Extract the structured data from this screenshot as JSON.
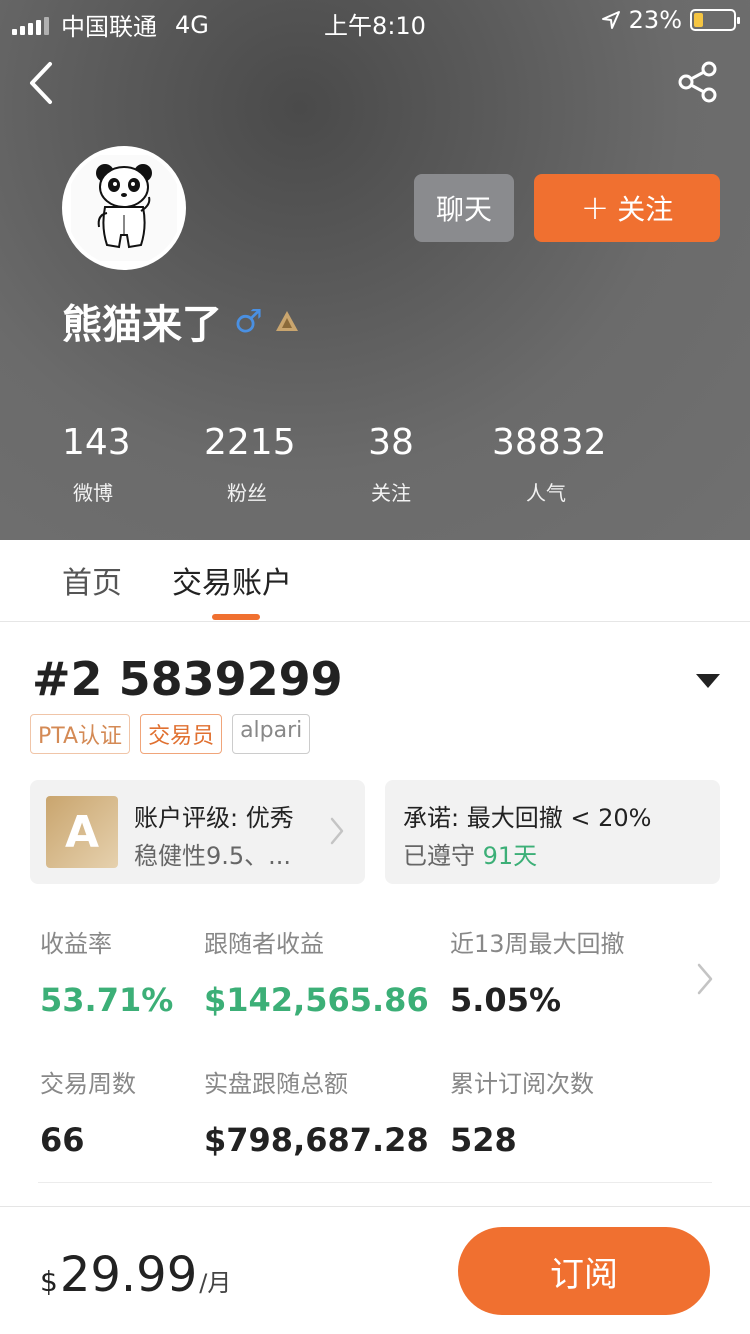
{
  "status_bar": {
    "carrier": "中国联通",
    "network": "4G",
    "time": "上午8:10",
    "battery": "23%",
    "battery_level": 0.23
  },
  "profile": {
    "name": "熊猫来了",
    "chat_label": "聊天",
    "follow_label": "关注",
    "stats": [
      {
        "value": "143",
        "label": "微博"
      },
      {
        "value": "2215",
        "label": "粉丝"
      },
      {
        "value": "38",
        "label": "关注"
      },
      {
        "value": "38832",
        "label": "人气"
      }
    ]
  },
  "tabs": [
    {
      "label": "首页",
      "active": false
    },
    {
      "label": "交易账户",
      "active": true
    }
  ],
  "account": {
    "id": "#2 5839299",
    "tags": [
      "PTA认证",
      "交易员",
      "alpari"
    ],
    "rating_card": {
      "grade": "A",
      "title": "账户评级: 优秀",
      "subtitle": "稳健性9.5、..."
    },
    "commitment_card": {
      "title": "承诺: 最大回撤 < 20%",
      "subtitle_prefix": "已遵守",
      "days": "91天"
    },
    "metrics": [
      {
        "label": "收益率",
        "value": "53.71%",
        "highlight": true
      },
      {
        "label": "跟随者收益",
        "value": "$142,565.86",
        "highlight": true
      },
      {
        "label": "近13周最大回撤",
        "value": "5.05%",
        "highlight": false
      },
      {
        "label": "交易周数",
        "value": "66",
        "highlight": false
      },
      {
        "label": "实盘跟随总额",
        "value": "$798,687.28",
        "highlight": false
      },
      {
        "label": "累计订阅次数",
        "value": "528",
        "highlight": false
      }
    ]
  },
  "subscription": {
    "currency": "$",
    "price": "29.99",
    "period": "/月",
    "button_label": "订阅"
  },
  "colors": {
    "accent": "#f07030",
    "positive": "#3caf77",
    "header_bg": "#606060"
  }
}
